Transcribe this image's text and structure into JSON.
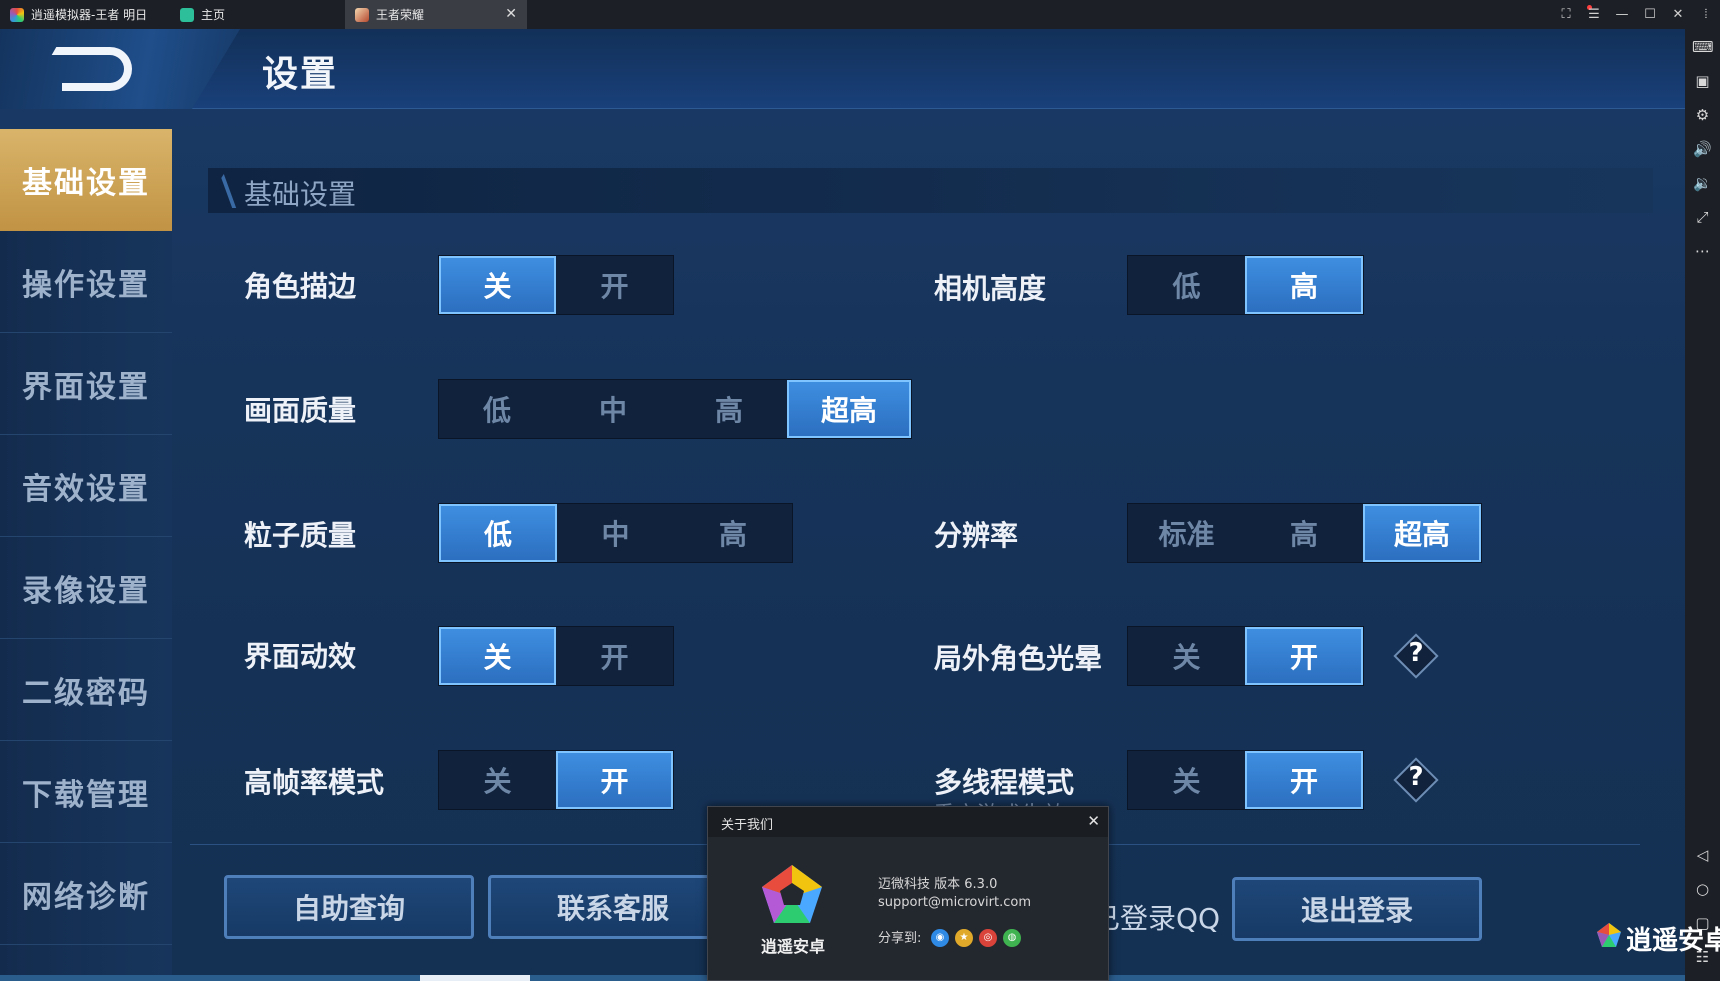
{
  "titlebar": {
    "tabs": [
      {
        "label": "逍遥模拟器-王者 明日"
      },
      {
        "label": "主页"
      },
      {
        "label": "王者荣耀"
      }
    ]
  },
  "header": {
    "title": "设置"
  },
  "sidebar": {
    "items": [
      {
        "label": "基础设置",
        "active": true
      },
      {
        "label": "操作设置"
      },
      {
        "label": "界面设置"
      },
      {
        "label": "音效设置"
      },
      {
        "label": "录像设置"
      },
      {
        "label": "二级密码"
      },
      {
        "label": "下载管理"
      },
      {
        "label": "网络诊断"
      }
    ]
  },
  "section": {
    "title": "基础设置"
  },
  "settings": {
    "outline": {
      "label": "角色描边",
      "options": [
        "关",
        "开"
      ],
      "selected": "关"
    },
    "quality": {
      "label": "画面质量",
      "options": [
        "低",
        "中",
        "高",
        "超高"
      ],
      "selected": "超高"
    },
    "particle": {
      "label": "粒子质量",
      "options": [
        "低",
        "中",
        "高"
      ],
      "selected": "低"
    },
    "ui_effect": {
      "label": "界面动效",
      "options": [
        "关",
        "开"
      ],
      "selected": "关"
    },
    "high_fps": {
      "label": "高帧率模式",
      "options": [
        "关",
        "开"
      ],
      "selected": "开"
    },
    "camera": {
      "label": "相机高度",
      "options": [
        "低",
        "高"
      ],
      "selected": "高"
    },
    "resolution": {
      "label": "分辨率",
      "options": [
        "标准",
        "高",
        "超高"
      ],
      "selected": "超高"
    },
    "glow": {
      "label": "局外角色光晕",
      "options": [
        "关",
        "开"
      ],
      "selected": "开"
    },
    "multithread": {
      "label": "多线程模式",
      "options": [
        "关",
        "开"
      ],
      "selected": "开",
      "note": "重启游戏生效"
    }
  },
  "help_icon": "?",
  "bottom": {
    "self_query": "自助查询",
    "contact": "联系客服",
    "login_qq": "已登录QQ",
    "logout": "退出登录"
  },
  "watermark": "逍遥安卓",
  "dialog": {
    "title": "关于我们",
    "brand": "逍遥安卓",
    "company_version": "迈微科技  版本 6.3.0",
    "email": "support@microvirt.com",
    "share_label": "分享到:",
    "share_icons": [
      "qq-icon",
      "qzone-icon",
      "weibo-icon",
      "wechat-icon"
    ]
  },
  "colors": {
    "selected": "#3e8ee0",
    "active_nav": "#d9b46a",
    "background": "#163359"
  }
}
